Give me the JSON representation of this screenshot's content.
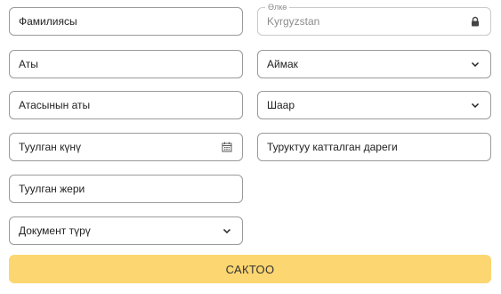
{
  "form": {
    "left": {
      "surname": {
        "placeholder": "Фамилиясы"
      },
      "name": {
        "placeholder": "Аты"
      },
      "patronymic": {
        "placeholder": "Атасынын аты"
      },
      "birth_date": {
        "placeholder": "Туулган күнү",
        "icon": "calendar-icon"
      },
      "birth_place": {
        "placeholder": "Туулган жери"
      },
      "document_type": {
        "value": "Документ түрү",
        "icon": "chevron-down-icon"
      }
    },
    "right": {
      "country": {
        "legend": "Өлкө",
        "value": "Kyrgyzstan",
        "icon": "lock-icon"
      },
      "region": {
        "value": "Аймак",
        "icon": "chevron-down-icon"
      },
      "city": {
        "value": "Шаар",
        "icon": "chevron-down-icon"
      },
      "address": {
        "placeholder": "Туруктуу катталган дареги"
      }
    },
    "submit_label": "САКТОО"
  },
  "colors": {
    "submit_bg": "#fcd670",
    "border": "#9a9a9a",
    "disabled_text": "#8c8c8c"
  }
}
